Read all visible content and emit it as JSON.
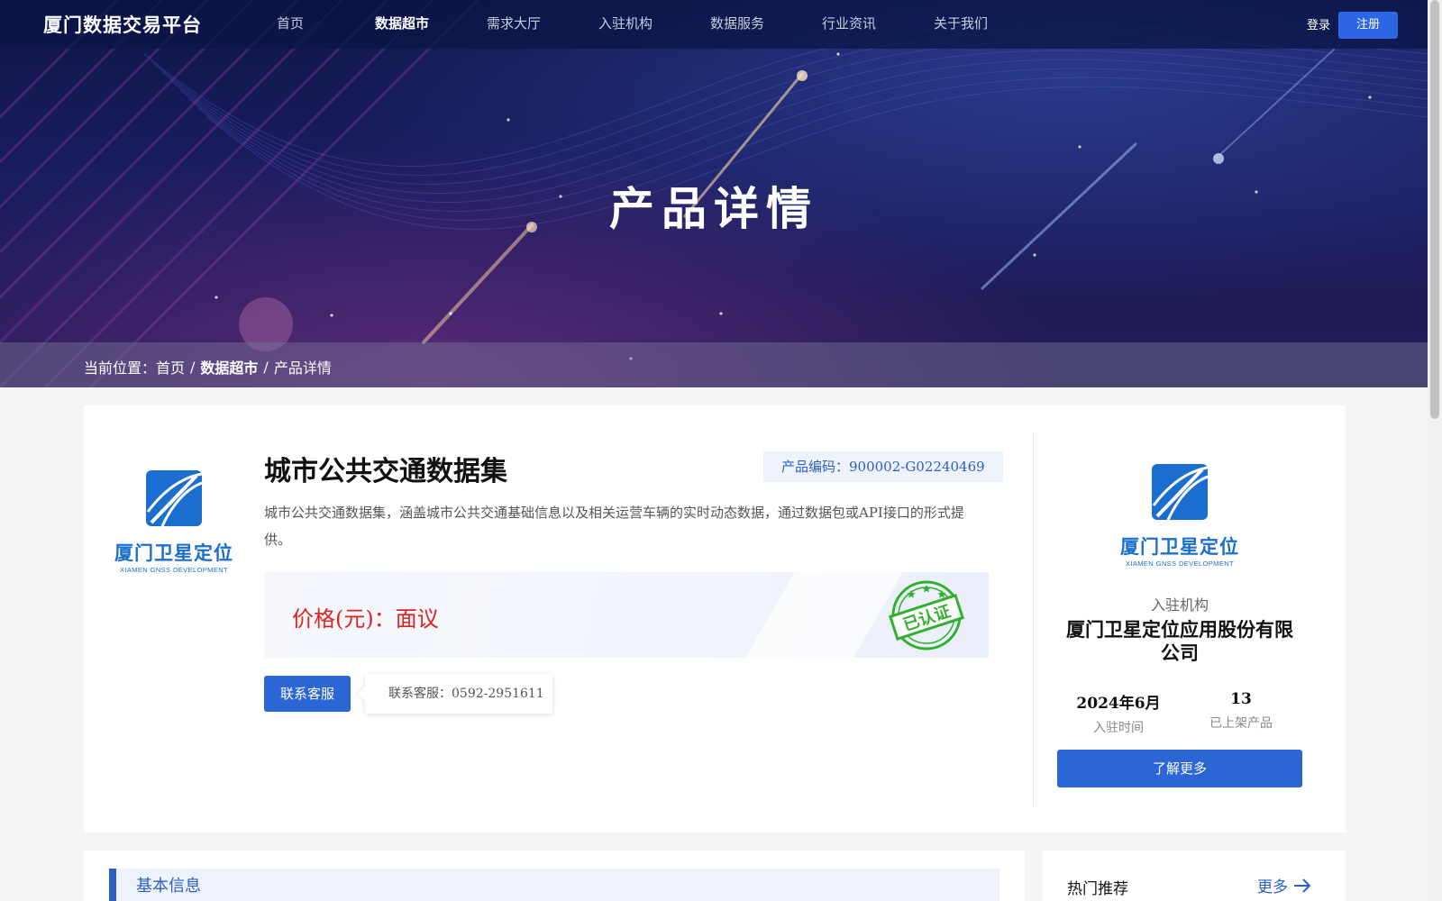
{
  "nav": {
    "brand": "厦门数据交易平台",
    "items": [
      "首页",
      "数据超市",
      "需求大厅",
      "入驻机构",
      "数据服务",
      "行业资讯",
      "关于我们"
    ],
    "active_index": 1,
    "login": "登录",
    "register": "注册"
  },
  "hero": {
    "title": "产品详情"
  },
  "breadcrumb": {
    "prefix": "当前位置：首页",
    "sep1": "/",
    "market": "数据超市",
    "sep2": "/",
    "current": "产品详情"
  },
  "product": {
    "title": "城市公共交通数据集",
    "code": "产品编码：900002-G02240469",
    "description": "城市公共交通数据集，涵盖城市公共交通基础信息以及相关运营车辆的实时动态数据，通过数据包或API接口的形式提供。",
    "price": "价格(元)：面议",
    "certified_stamp": "已认证",
    "contact_button": "联系客服",
    "contact_tooltip": "联系客服：0592-2951611"
  },
  "logo": {
    "name": "厦门卫星定位",
    "english": "XIAMEN GNSS DEVELOPMENT"
  },
  "organization": {
    "tag": "入驻机构",
    "name": "厦门卫星定位应用股份有限公司",
    "joined_value": "2024年6月",
    "joined_label": "入驻时间",
    "products_value": "13",
    "products_label": "已上架产品",
    "more_button": "了解更多"
  },
  "sections": {
    "basic_info": "基本信息",
    "hot_title": "热门推荐",
    "hot_more": "更多"
  },
  "colors": {
    "accent": "#2c66d6",
    "price": "#e0241c",
    "stamp": "#2fb12f",
    "logo": "#1a6ed0"
  }
}
